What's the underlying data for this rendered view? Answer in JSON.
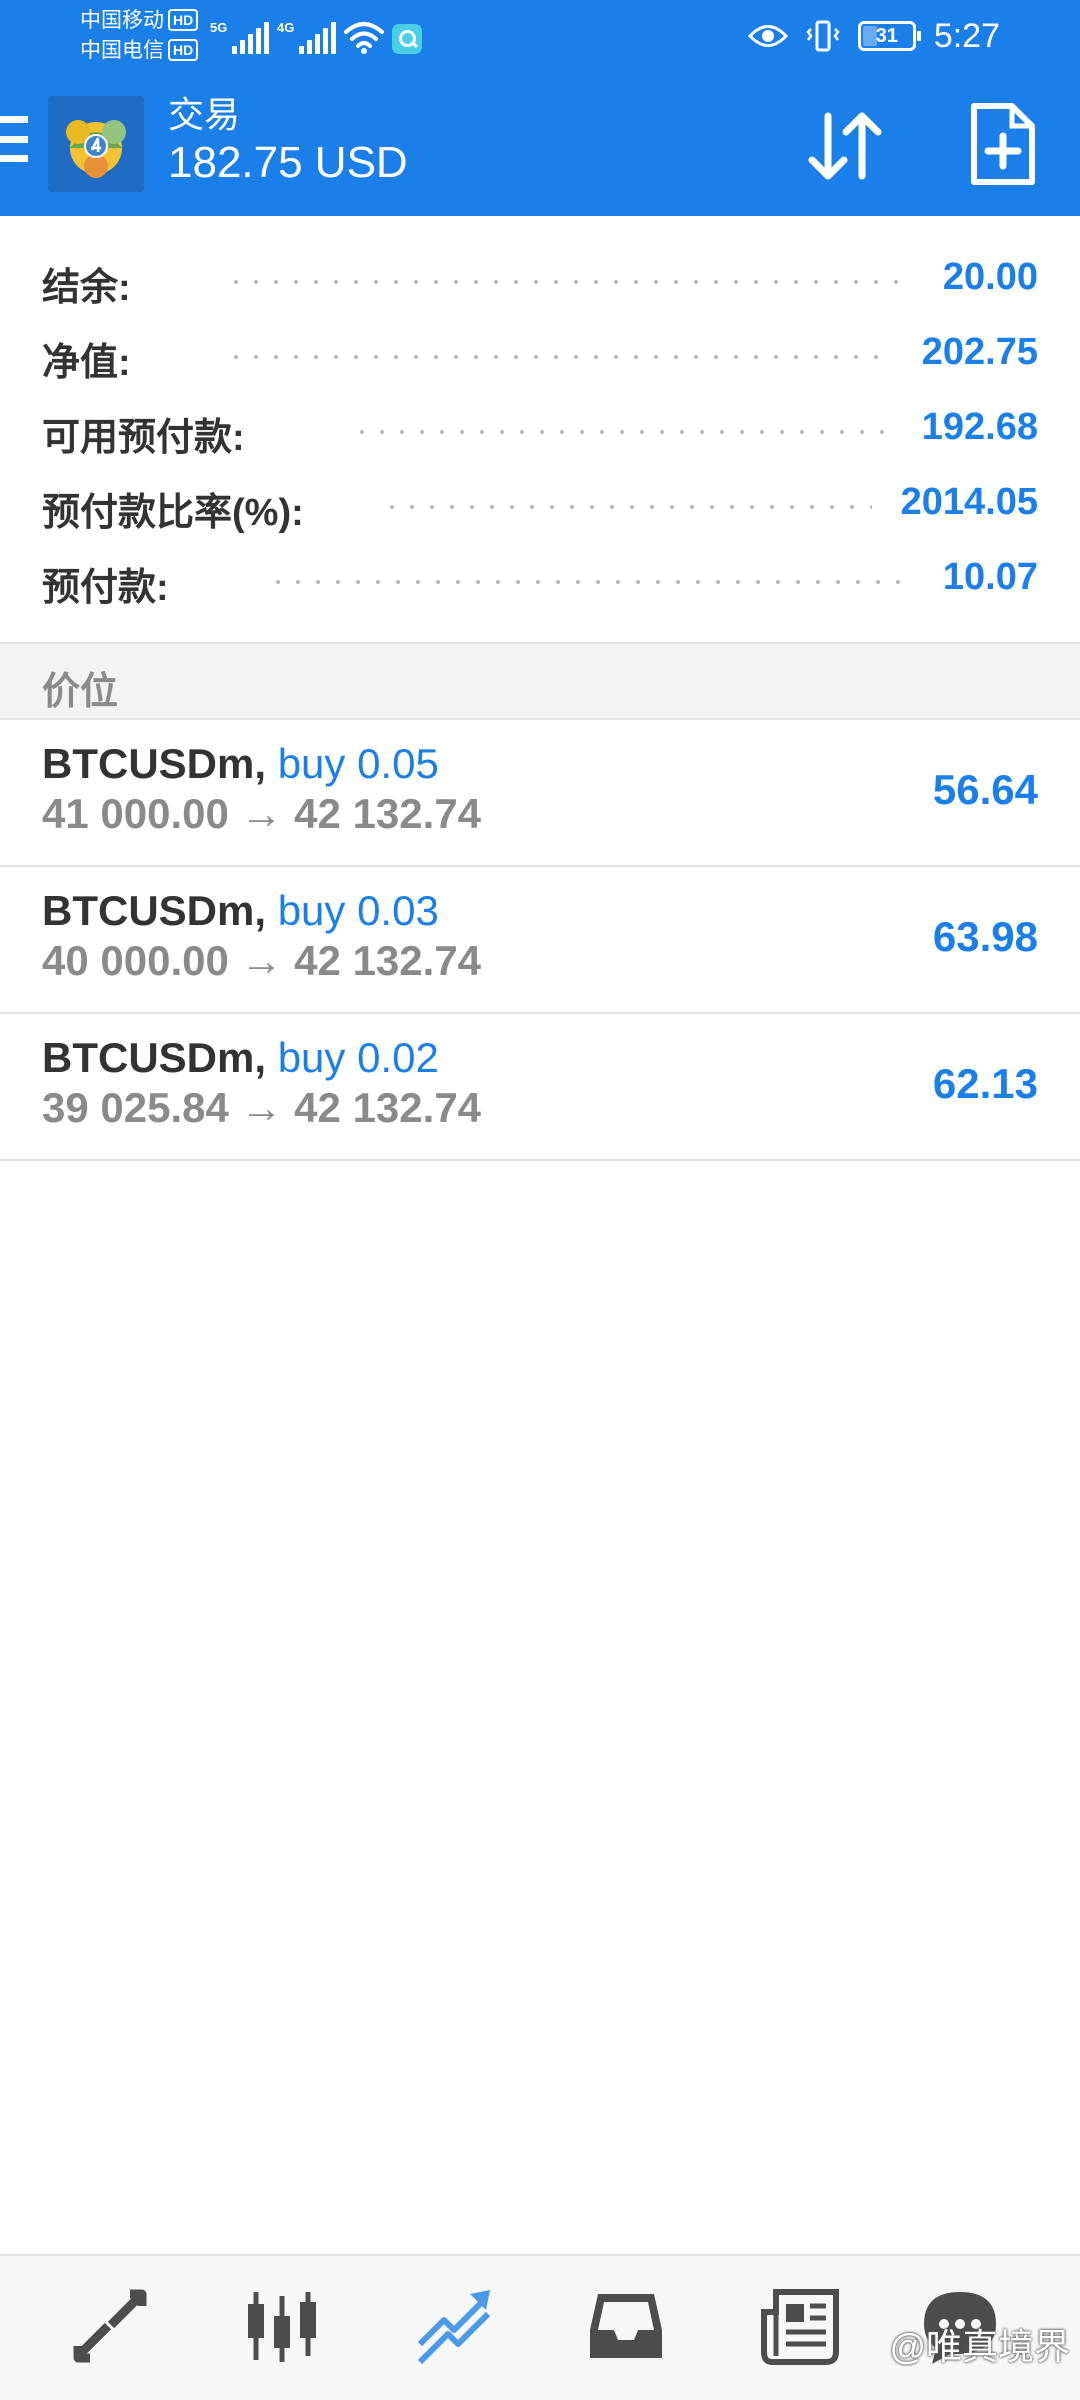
{
  "status_bar": {
    "carrier1": "中国移动",
    "carrier2": "中国电信",
    "hd_badge": "HD",
    "net1": "5G",
    "net2": "4G",
    "battery_level": "31",
    "time": "5:27",
    "icons": [
      "signal-icon",
      "wifi-icon",
      "search-app-icon",
      "eye-icon",
      "vibrate-icon",
      "battery-icon"
    ]
  },
  "app_bar": {
    "title": "交易",
    "balance": "182.75 USD",
    "icons": [
      "menu-icon",
      "metatrader-logo",
      "sort-icon",
      "new-order-icon"
    ]
  },
  "summary": [
    {
      "label": "结余:",
      "value": "20.00"
    },
    {
      "label": "净值:",
      "value": "202.75"
    },
    {
      "label": "可用预付款:",
      "value": "192.68"
    },
    {
      "label": "预付款比率(%):",
      "value": "2014.05"
    },
    {
      "label": "预付款:",
      "value": "10.07"
    }
  ],
  "positions_header": "价位",
  "positions": [
    {
      "symbol": "BTCUSDm,",
      "side": "buy 0.05",
      "prices": "41 000.00 → 42 132.74",
      "profit": "56.64"
    },
    {
      "symbol": "BTCUSDm,",
      "side": "buy 0.03",
      "prices": "40 000.00 → 42 132.74",
      "profit": "63.98"
    },
    {
      "symbol": "BTCUSDm,",
      "side": "buy 0.02",
      "prices": "39 025.84 → 42 132.74",
      "profit": "62.13"
    }
  ],
  "bottom_nav": {
    "items": [
      "quotes-icon",
      "chart-icon",
      "trade-icon",
      "history-icon",
      "news-icon",
      "chat-icon"
    ],
    "active": "trade-icon"
  },
  "watermark": "@唯真境界",
  "colors": {
    "primary": "#1a7fe8",
    "active_nav": "#4a9ae8",
    "inactive_nav": "#4d4d4d"
  }
}
